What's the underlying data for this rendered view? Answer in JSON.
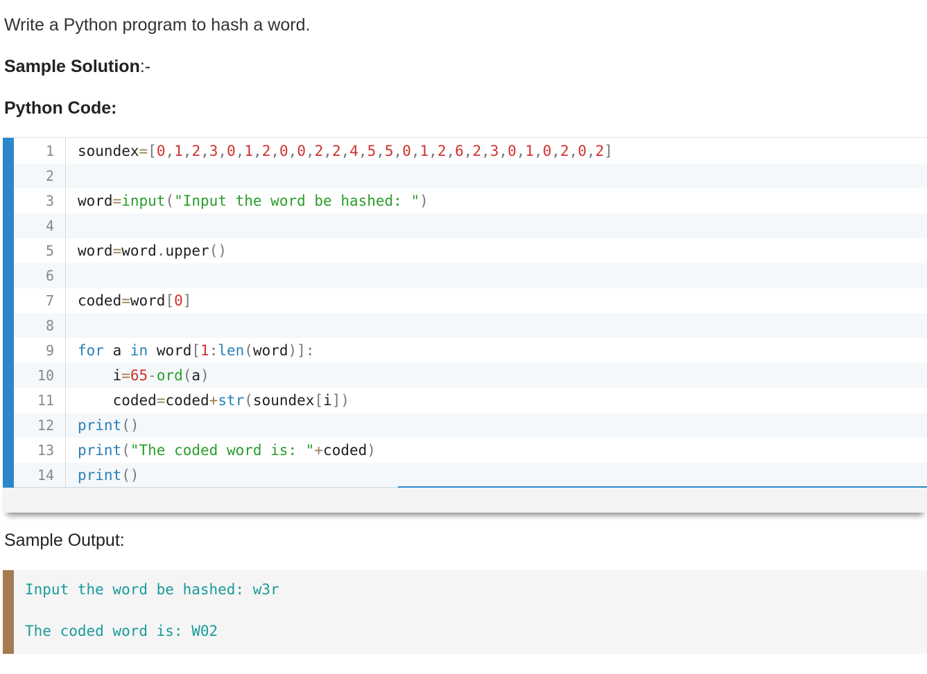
{
  "question": "Write a Python program to hash a word.",
  "solution_heading": "Sample Solution",
  "solution_suffix": ":-",
  "code_heading": "Python Code:",
  "code": {
    "line_numbers": [
      "1",
      "2",
      "3",
      "4",
      "5",
      "6",
      "7",
      "8",
      "9",
      "10",
      "11",
      "12",
      "13",
      "14"
    ],
    "lines": [
      "soundex=[0,1,2,3,0,1,2,0,0,2,2,4,5,5,0,1,2,6,2,3,0,1,0,2,0,2]",
      "",
      "word=input(\"Input the word be hashed: \")",
      "",
      "word=word.upper()",
      "",
      "coded=word[0]",
      "",
      "for a in word[1:len(word)]:",
      "    i=65-ord(a)",
      "    coded=coded+str(soundex[i])",
      "print()",
      "print(\"The coded word is: \"+coded)",
      "print()"
    ]
  },
  "output_heading": "Sample Output:",
  "output": {
    "line1": "Input the word be hashed: w3r",
    "line2": "The coded word is: W02"
  },
  "colors": {
    "code_accent": "#2d86c9",
    "output_accent": "#a57c52",
    "output_text": "#1a9a9a",
    "keyword": "#2a7fb8",
    "string": "#2a9d2a",
    "number": "#d0312d"
  }
}
